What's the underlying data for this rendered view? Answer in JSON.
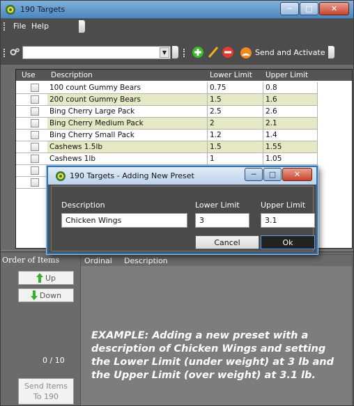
{
  "window": {
    "title": "190 Targets",
    "menu": [
      "File",
      "Help"
    ],
    "toolbar": {
      "send_label": "Send and Activate"
    }
  },
  "grid": {
    "columns": [
      "Use",
      "Description",
      "Lower Limit",
      "Upper Limit"
    ],
    "rows": [
      {
        "use": false,
        "description": "100 count Gummy Bears",
        "lower": "0.75",
        "upper": "0.8"
      },
      {
        "use": false,
        "description": "200 count Gummy Bears",
        "lower": "1.5",
        "upper": "1.6"
      },
      {
        "use": false,
        "description": "Bing Cherry Large Pack",
        "lower": "2.5",
        "upper": "2.6"
      },
      {
        "use": false,
        "description": "Bing Cherry Medium Pack",
        "lower": "2",
        "upper": "2.1"
      },
      {
        "use": false,
        "description": "Bing Cherry Small Pack",
        "lower": "1.2",
        "upper": "1.4"
      },
      {
        "use": false,
        "description": "Cashews 1.5lb",
        "lower": "1.5",
        "upper": "1.55"
      },
      {
        "use": false,
        "description": "Cashews 1lb",
        "lower": "1",
        "upper": "1.05"
      },
      {
        "use": false,
        "description": "",
        "lower": "",
        "upper": ""
      },
      {
        "use": false,
        "description": "",
        "lower": "",
        "upper": ""
      }
    ]
  },
  "order_pane": {
    "label": "Order of Items",
    "up_label": "Up",
    "down_label": "Down",
    "count": "0 / 10",
    "send_items_line1": "Send Items",
    "send_items_line2": "To 190",
    "columns": [
      "Ordinal",
      "Description"
    ]
  },
  "caption": {
    "prefix": "EXAMPLE:",
    "text": "Adding a new preset with a description of Chicken Wings and setting the Lower Limit (under weight) at 3 lb and the Upper Limit (over weight) at 3.1 lb."
  },
  "dialog": {
    "title": "190 Targets - Adding New Preset",
    "description_label": "Description",
    "lower_label": "Lower Limit",
    "upper_label": "Upper Limit",
    "description_value": "Chicken Wings",
    "lower_value": "3",
    "upper_value": "3.1",
    "cancel_label": "Cancel",
    "ok_label": "Ok"
  },
  "colors": {
    "title_bar": "#5a8fc4",
    "row_alt": "#e6e7c3",
    "ok_border": "#5ea0e3",
    "add_icon": "#3dbb2c",
    "edit_icon": "#f0b020",
    "remove_icon": "#e03c30"
  }
}
